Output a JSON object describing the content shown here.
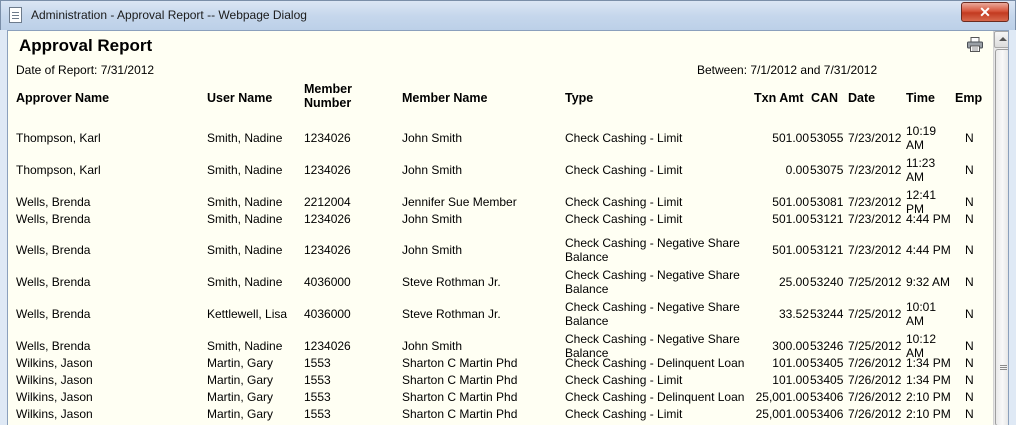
{
  "window": {
    "title": "Administration - Approval Report -- Webpage Dialog",
    "close_label": "✕"
  },
  "report": {
    "title": "Approval Report",
    "date_of_report": "Date of Report: 7/31/2012",
    "between": "Between: 7/1/2012 and 7/31/2012"
  },
  "columns": {
    "approver": "Approver Name",
    "user": "User Name",
    "member_number": "Member Number",
    "member_name": "Member Name",
    "type": "Type",
    "txn_amt": "Txn Amt",
    "can": "CAN",
    "date": "Date",
    "time": "Time",
    "emp": "Emp"
  },
  "rows": [
    {
      "approver": "Thompson, Karl",
      "user": "Smith, Nadine",
      "member_number": "1234026",
      "member_name": "John Smith",
      "type": "Check Cashing - Limit",
      "txn_amt": "501.00",
      "can": "53055",
      "date": "7/23/2012",
      "time": "10:19 AM",
      "emp": "N"
    },
    {
      "approver": "Thompson, Karl",
      "user": "Smith, Nadine",
      "member_number": "1234026",
      "member_name": "John Smith",
      "type": "Check Cashing - Limit",
      "txn_amt": "0.00",
      "can": "53075",
      "date": "7/23/2012",
      "time": "11:23 AM",
      "emp": "N"
    },
    {
      "approver": "Wells, Brenda",
      "user": "Smith, Nadine",
      "member_number": "2212004",
      "member_name": "Jennifer Sue Member",
      "type": "Check Cashing - Limit",
      "txn_amt": "501.00",
      "can": "53081",
      "date": "7/23/2012",
      "time": "12:41 PM",
      "emp": "N"
    },
    {
      "approver": "Wells, Brenda",
      "user": "Smith, Nadine",
      "member_number": "1234026",
      "member_name": "John Smith",
      "type": "Check Cashing - Limit",
      "txn_amt": "501.00",
      "can": "53121",
      "date": "7/23/2012",
      "time": "4:44 PM",
      "emp": "N"
    },
    {
      "approver": "Wells, Brenda",
      "user": "Smith, Nadine",
      "member_number": "1234026",
      "member_name": "John Smith",
      "type": "Check Cashing - Negative Share Balance",
      "txn_amt": "501.00",
      "can": "53121",
      "date": "7/23/2012",
      "time": "4:44 PM",
      "emp": "N"
    },
    {
      "approver": "Wells, Brenda",
      "user": "Smith, Nadine",
      "member_number": "4036000",
      "member_name": "Steve Rothman Jr.",
      "type": "Check Cashing - Negative Share Balance",
      "txn_amt": "25.00",
      "can": "53240",
      "date": "7/25/2012",
      "time": "9:32 AM",
      "emp": "N"
    },
    {
      "approver": "Wells, Brenda",
      "user": "Kettlewell, Lisa",
      "member_number": "4036000",
      "member_name": "Steve Rothman Jr.",
      "type": "Check Cashing - Negative Share Balance",
      "txn_amt": "33.52",
      "can": "53244",
      "date": "7/25/2012",
      "time": "10:01 AM",
      "emp": "N"
    },
    {
      "approver": "Wells, Brenda",
      "user": "Smith, Nadine",
      "member_number": "1234026",
      "member_name": "John Smith",
      "type": "Check Cashing - Negative Share Balance",
      "txn_amt": "300.00",
      "can": "53246",
      "date": "7/25/2012",
      "time": "10:12 AM",
      "emp": "N"
    },
    {
      "approver": "Wilkins, Jason",
      "user": "Martin, Gary",
      "member_number": "1553",
      "member_name": "Sharton C Martin Phd",
      "type": "Check Cashing - Delinquent Loan",
      "txn_amt": "101.00",
      "can": "53405",
      "date": "7/26/2012",
      "time": "1:34 PM",
      "emp": "N"
    },
    {
      "approver": "Wilkins, Jason",
      "user": "Martin, Gary",
      "member_number": "1553",
      "member_name": "Sharton C Martin Phd",
      "type": "Check Cashing - Limit",
      "txn_amt": "101.00",
      "can": "53405",
      "date": "7/26/2012",
      "time": "1:34 PM",
      "emp": "N"
    },
    {
      "approver": "Wilkins, Jason",
      "user": "Martin, Gary",
      "member_number": "1553",
      "member_name": "Sharton C Martin Phd",
      "type": "Check Cashing - Delinquent Loan",
      "txn_amt": "25,001.00",
      "can": "53406",
      "date": "7/26/2012",
      "time": "2:10 PM",
      "emp": "N"
    },
    {
      "approver": "Wilkins, Jason",
      "user": "Martin, Gary",
      "member_number": "1553",
      "member_name": "Sharton C Martin Phd",
      "type": "Check Cashing - Limit",
      "txn_amt": "25,001.00",
      "can": "53406",
      "date": "7/26/2012",
      "time": "2:10 PM",
      "emp": "N"
    }
  ]
}
